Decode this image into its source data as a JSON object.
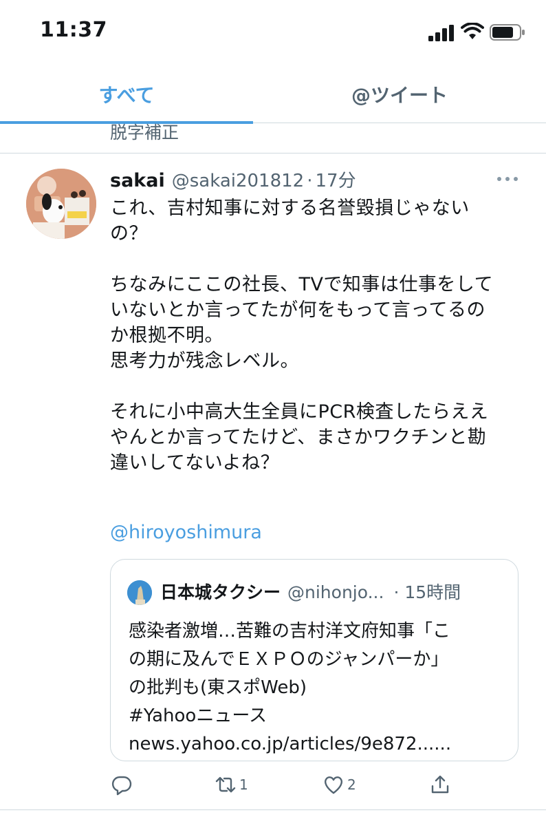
{
  "status_bar": {
    "time": "11:37"
  },
  "tabs": [
    {
      "label": "すべて",
      "active": true
    },
    {
      "label": "@ツイート",
      "active": false
    }
  ],
  "previous_tweet": {
    "text_fragment": "脱字補正"
  },
  "tweet": {
    "user_name": "sakai",
    "user_handle": "@sakai201812",
    "separator": "·",
    "time": "17分",
    "avatar_icon": "snoopy-avatar-icon",
    "body_lines": [
      "これ、吉村知事に対する名誉毀損じゃない",
      "の？",
      "",
      "ちなみにここの社長、TVで知事は仕事をして",
      "いないとか言ってたが何をもって言ってるの",
      "か根拠不明。",
      "思考力が残念レベル。",
      "",
      "それに小中高大生全員にPCR検査したらええ",
      "やんとか言ってたけど、まさかワクチンと勘",
      "違いしてないよね？"
    ],
    "mention": "@hiroyoshimura",
    "quote": {
      "user_name": "日本城タクシー",
      "user_handle": "@nihonjo...",
      "time": "· 15時間",
      "lines": [
        "感染者激増…苦難の吉村洋文府知事「こ",
        "の期に及んでＥＸＰＯのジャンパーか」",
        "の批判も(東スポWeb)",
        "#Yahooニュース",
        "news.yahoo.co.jp/articles/9e872......"
      ]
    },
    "actions": {
      "reply_icon": "reply-icon",
      "retweet_icon": "retweet-icon",
      "retweet_count": "1",
      "like_icon": "heart-icon",
      "like_count": "2",
      "share_icon": "share-icon"
    }
  },
  "colors": {
    "accent": "#4a9ee0",
    "secondary_text": "#536471",
    "border": "#cfd9de"
  }
}
